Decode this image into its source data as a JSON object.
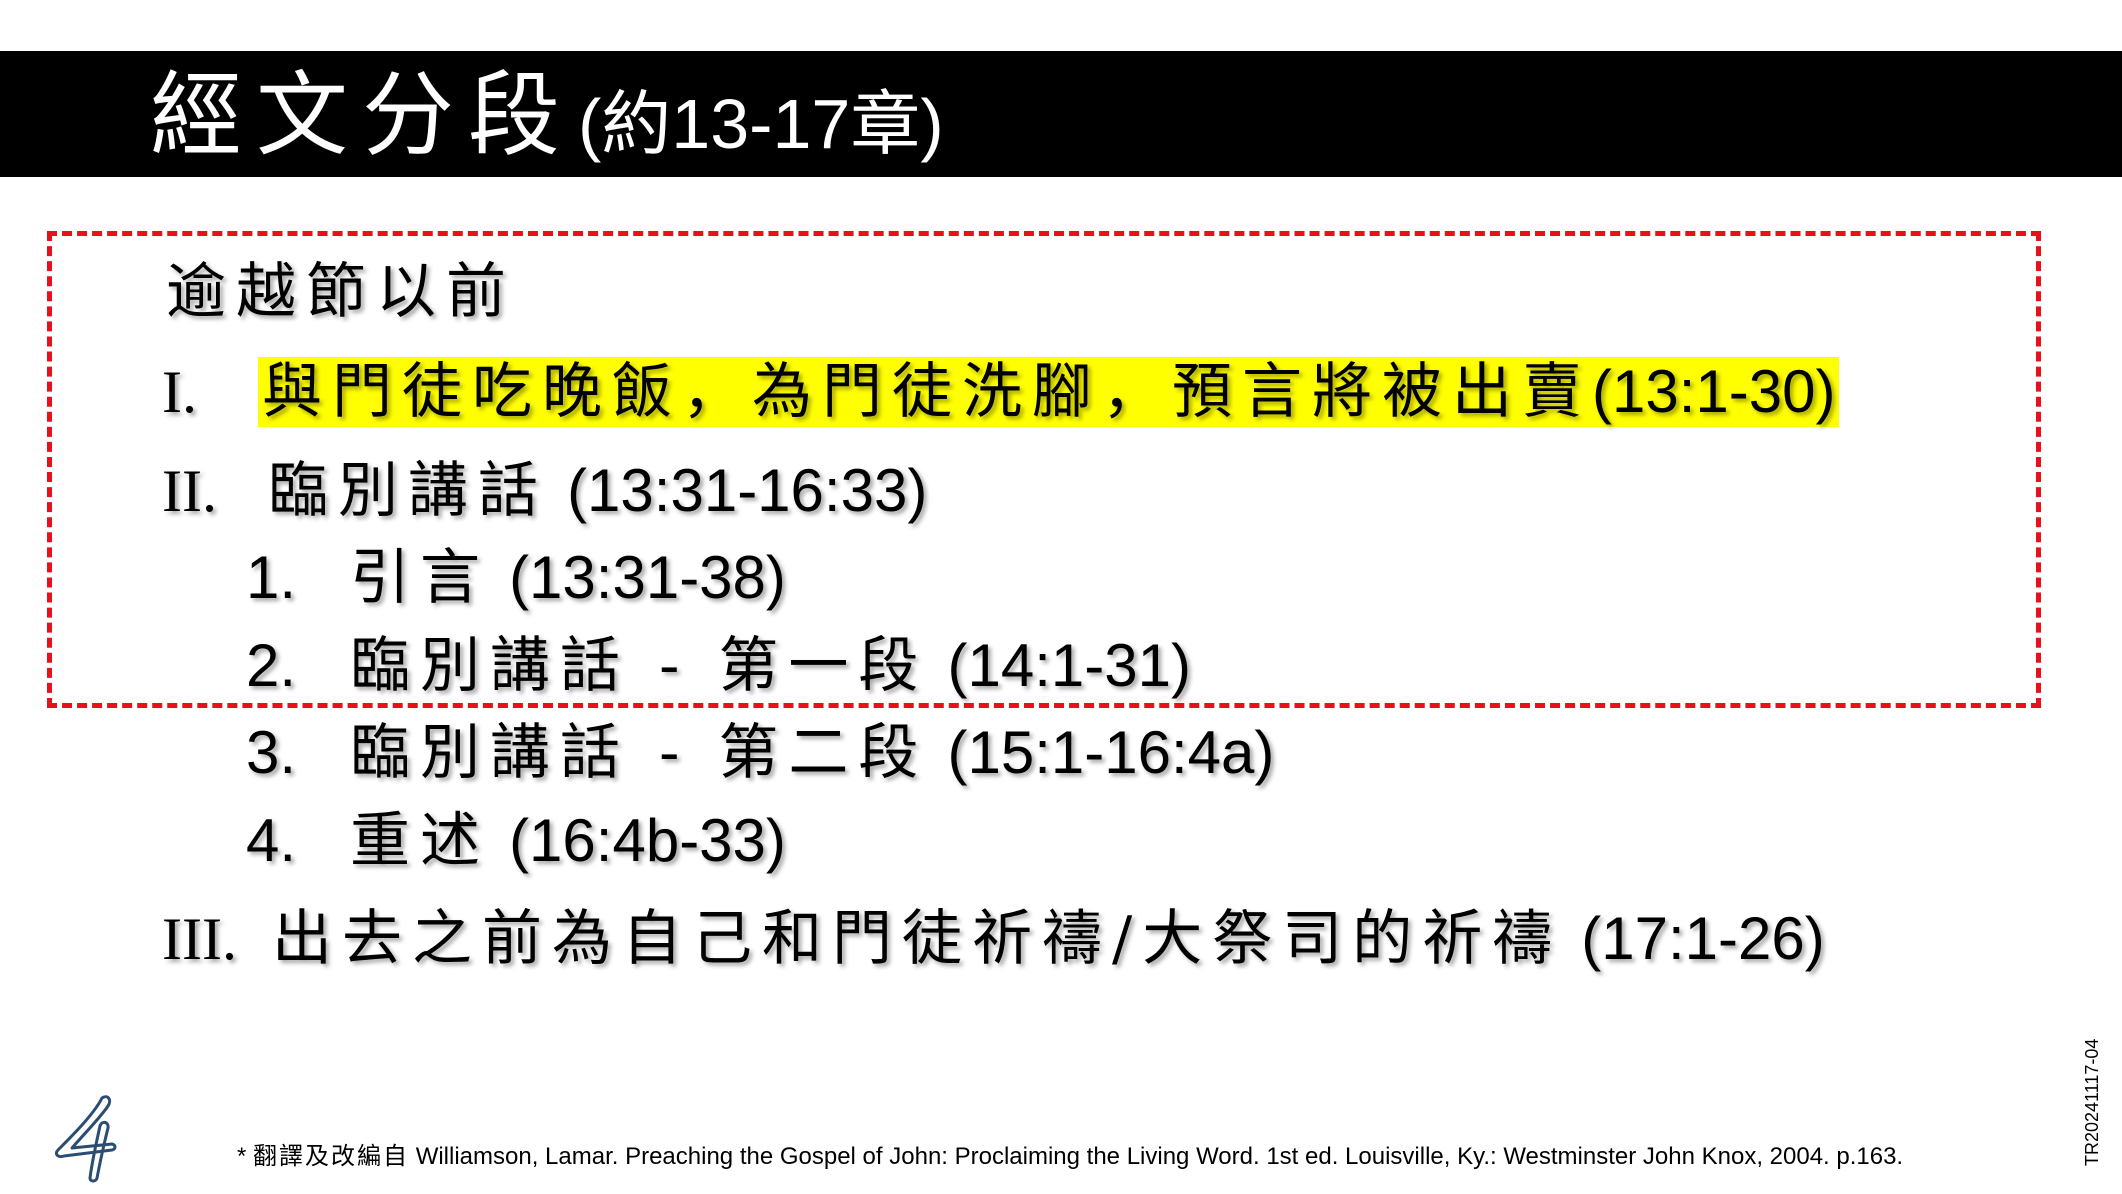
{
  "title": {
    "main": "經文分段",
    "sub": "(約13-17章)"
  },
  "outline": {
    "group_heading": "逾越節以前",
    "item1": {
      "marker": "I.",
      "text": "與門徒吃晚飯，為門徒洗腳，預言將被出賣",
      "ref": "(13:1-30)"
    },
    "item2": {
      "marker": "II.",
      "text": "臨別講話",
      "ref": "(13:31-16:33)"
    },
    "sub1": {
      "marker": "1.",
      "text": "引言",
      "ref": "(13:31-38)"
    },
    "sub2": {
      "marker": "2.",
      "text": "臨別講話 - 第一段",
      "ref": "(14:1-31)"
    },
    "sub3": {
      "marker": "3.",
      "text": "臨別講話 - 第二段",
      "ref": "(15:1-16:4a)"
    },
    "sub4": {
      "marker": "4.",
      "text": "重述",
      "ref": "(16:4b-33)"
    },
    "item3": {
      "marker": "III.",
      "text": "出去之前為自己和門徒祈禱/大祭司的祈禱",
      "ref": "(17:1-26)"
    }
  },
  "footnote": {
    "star": "*",
    "prefix": "翻譯及改編自",
    "citation": "Williamson, Lamar. Preaching the Gospel of John: Proclaiming the Living Word. 1st ed. Louisville, Ky.: Westminster John Knox, 2004. p.163."
  },
  "page_number": "4",
  "side_code": "TR20241117-04",
  "colors": {
    "title_bar": "#000000",
    "title_text": "#ffffff",
    "highlight": "#ffff00",
    "dashed_border": "#e8101a"
  }
}
